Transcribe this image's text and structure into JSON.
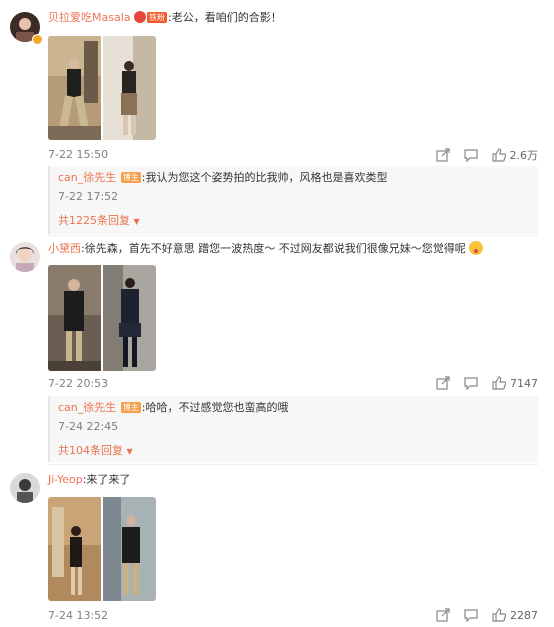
{
  "comments": [
    {
      "username": "贝拉爱吃Masala",
      "fan_badge": "铁粉",
      "text": ":老公，看咱们的合影！",
      "time": "7-22 15:50",
      "likes": "2.6万",
      "reply": {
        "username": "can_徐先生",
        "badge": "博主",
        "text": ":我认为您这个姿势拍的比我帅，风格也是喜欢类型",
        "time": "7-22 17:52",
        "more_label": "共1225条回复"
      }
    },
    {
      "username": "小黛西",
      "text": ":徐先森，首先不好意思 蹭您一波热度～ 不过网友都说我们很像兄妹～您觉得呢",
      "time": "7-22 20:53",
      "likes": "7147",
      "reply": {
        "username": "can_徐先生",
        "badge": "博主",
        "text": ":哈哈，不过感觉您也蛮高的哦",
        "time": "7-24 22:45",
        "more_label": "共104条回复"
      }
    },
    {
      "username": "Ji-Yeop",
      "text": ":来了来了",
      "time": "7-24 13:52",
      "likes": "2287"
    }
  ],
  "icons": {
    "share": "share-icon",
    "comment": "comment-icon",
    "like": "thumbs-up-icon",
    "expand": "caret-down-icon"
  },
  "colors": {
    "username": "#eb7350",
    "blogger_badge": "#f6a04d",
    "fan_badge": "#f25a29"
  }
}
